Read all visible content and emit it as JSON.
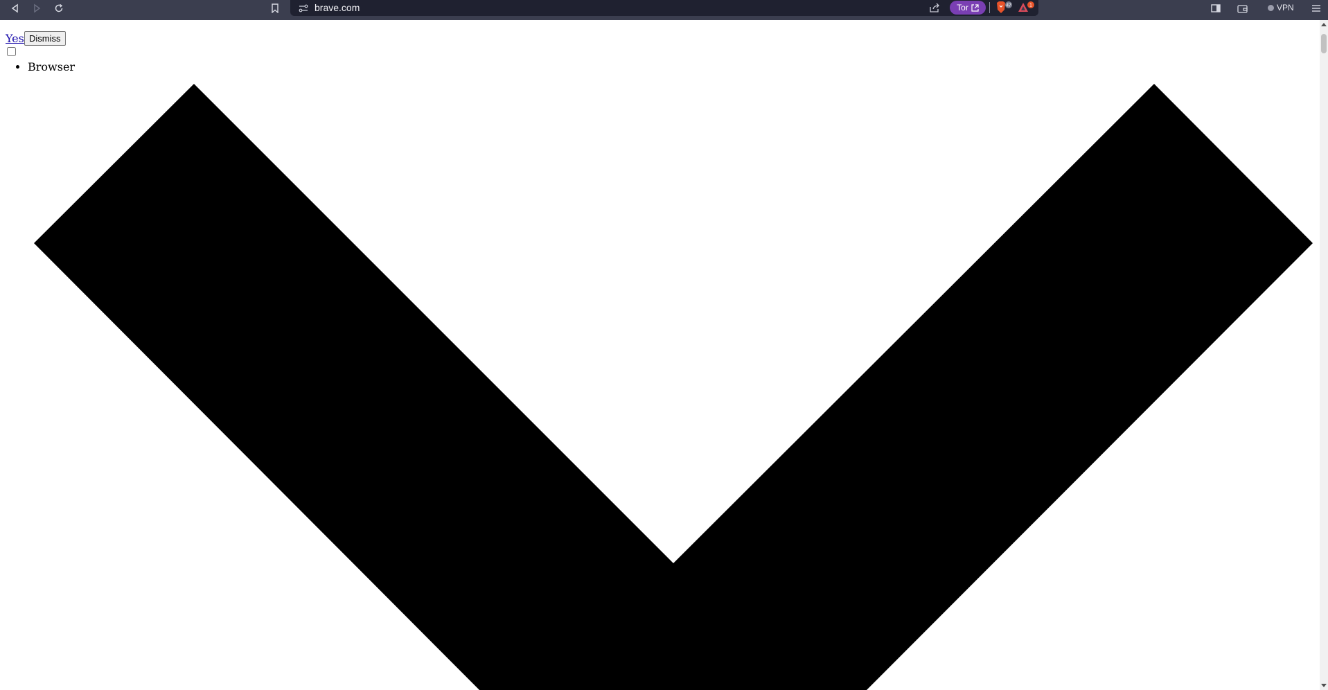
{
  "browser": {
    "url": "brave.com",
    "tor_label": "Tor",
    "shields_badge": "47",
    "rewards_badge": "1",
    "vpn_label": "VPN"
  },
  "page": {
    "prompt_link": "Yes",
    "dismiss_button": "Dismiss",
    "nav_items": [
      "Browser"
    ]
  },
  "icons": {
    "back": "back-icon",
    "forward": "forward-icon",
    "reload": "reload-icon",
    "bookmark": "bookmark-icon",
    "site_info": "site-info-icon",
    "share": "share-icon",
    "tor_open": "external-link-icon",
    "brave_shields": "brave-lion-icon",
    "brave_rewards": "triangle-icon",
    "sidebar": "sidebar-icon",
    "wallet": "wallet-icon",
    "menu": "hamburger-menu-icon",
    "chevron": "chevron-down-icon"
  },
  "colors": {
    "toolbar_bg": "#3b3e4f",
    "urlbar_bg": "#1f2130",
    "tor_purple": "#7a3fb3",
    "link_blue": "#1a0dab",
    "chevron_fill": "#000000"
  }
}
